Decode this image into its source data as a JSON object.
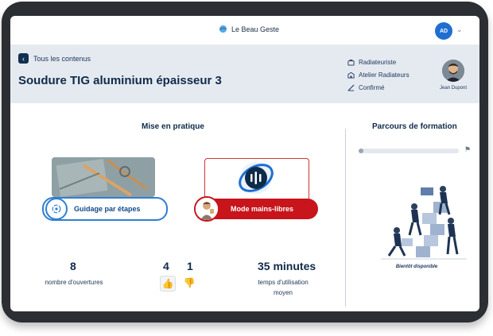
{
  "app": {
    "name": "Le Beau Geste",
    "user_initials": "AD"
  },
  "header": {
    "back_label": "Tous les contenus",
    "title": "Soudure TIG aluminium épaisseur 3",
    "meta": [
      "Radiateuriste",
      "Atelier Radiateurs",
      "Confirmé"
    ],
    "trainer_name": "Jean Dupont"
  },
  "practice": {
    "title": "Mise en pratique",
    "guide_label": "Guidage par étapes",
    "hands_free_label": "Mode mains-libres"
  },
  "stats": {
    "openings_value": "8",
    "openings_label": "nombre d'ouvertures",
    "likes": "4",
    "dislikes": "1",
    "usage_value": "35 minutes",
    "usage_label_line1": "temps d'utilisation",
    "usage_label_line2": "moyen"
  },
  "training_path": {
    "title": "Parcours de formation",
    "progress": 0,
    "status": "Bientôt disponible"
  },
  "colors": {
    "accent": "#2e7fd3",
    "danger": "#c8141b",
    "navy": "#0f2b4a",
    "header_bg": "#e5eaf1"
  }
}
